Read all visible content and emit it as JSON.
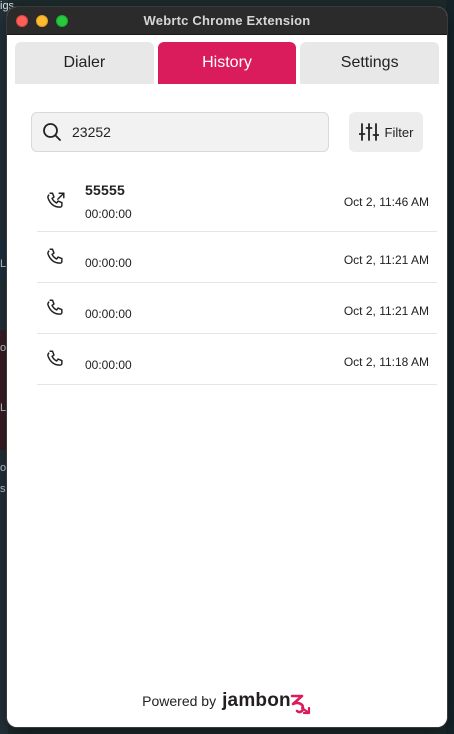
{
  "backdrop": {
    "top_text": "igs",
    "fragments": [
      "Le",
      "od",
      "Le",
      "o",
      "se"
    ]
  },
  "window": {
    "title": "Webrtc Chrome Extension"
  },
  "tabs": [
    {
      "label": "Dialer",
      "active": false
    },
    {
      "label": "History",
      "active": true
    },
    {
      "label": "Settings",
      "active": false
    }
  ],
  "search": {
    "value": "23252",
    "icon": "search-icon"
  },
  "filter": {
    "label": "Filter",
    "icon": "sliders-icon"
  },
  "history": [
    {
      "number": "55555",
      "duration": "00:00:00",
      "time": "Oct 2, 11:46 AM",
      "icon": "outgoing-call-icon"
    },
    {
      "number": "",
      "duration": "00:00:00",
      "time": "Oct 2, 11:21 AM",
      "icon": "phone-icon"
    },
    {
      "number": "",
      "duration": "00:00:00",
      "time": "Oct 2, 11:21 AM",
      "icon": "phone-icon"
    },
    {
      "number": "",
      "duration": "00:00:00",
      "time": "Oct 2, 11:18 AM",
      "icon": "phone-icon"
    }
  ],
  "footer": {
    "powered_by": "Powered by",
    "brand": "jambon"
  },
  "colors": {
    "accent": "#da1c5c",
    "tab_inactive": "#e8e8e8",
    "titlebar": "#2b2b2b"
  }
}
